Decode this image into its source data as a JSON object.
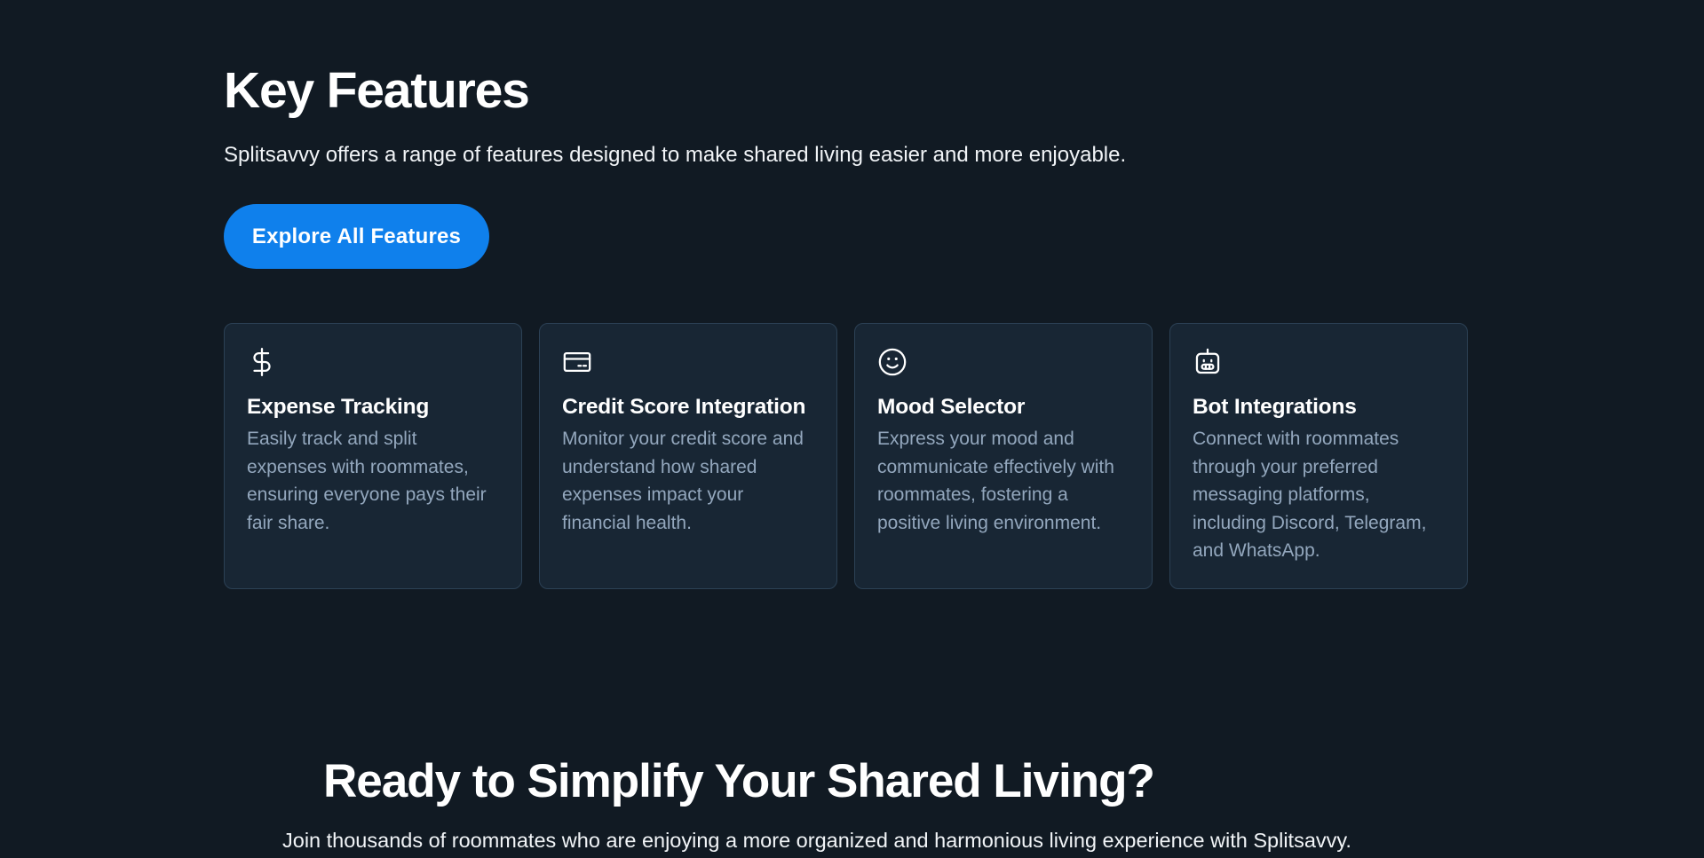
{
  "features": {
    "title": "Key Features",
    "subtitle": "Splitsavvy offers a range of features designed to make shared living easier and more enjoyable.",
    "button_label": "Explore All Features",
    "cards": [
      {
        "icon": "dollar-icon",
        "title": "Expense Tracking",
        "description": "Easily track and split expenses with roommates, ensuring everyone pays their fair share."
      },
      {
        "icon": "credit-card-icon",
        "title": "Credit Score Integration",
        "description": "Monitor your credit score and understand how shared expenses impact your financial health."
      },
      {
        "icon": "smile-icon",
        "title": "Mood Selector",
        "description": "Express your mood and communicate effectively with roommates, fostering a positive living environment."
      },
      {
        "icon": "bot-icon",
        "title": "Bot Integrations",
        "description": "Connect with roommates through your preferred messaging platforms, including Discord, Telegram, and WhatsApp."
      }
    ]
  },
  "cta": {
    "title": "Ready to Simplify Your Shared Living?",
    "subtitle": "Join thousands of roommates who are enjoying a more organized and harmonious living experience with Splitsavvy."
  },
  "colors": {
    "background": "#111a23",
    "card_background": "#182634",
    "card_border": "#2c4155",
    "accent": "#0f80ec",
    "muted_text": "#93a7bd"
  }
}
